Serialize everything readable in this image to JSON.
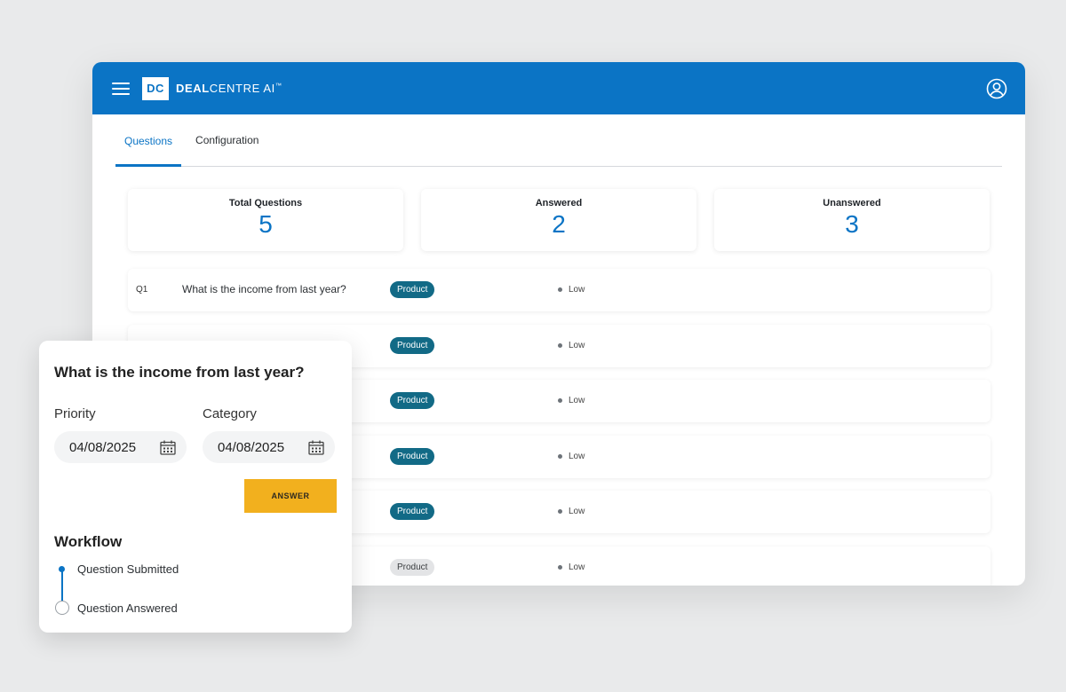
{
  "header": {
    "logo_text": "DC",
    "brand_bold": "DEAL",
    "brand_rest": "CENTRE AI",
    "brand_mark": "™"
  },
  "tabs": [
    {
      "label": "Questions",
      "active": true
    },
    {
      "label": "Configuration",
      "active": false
    }
  ],
  "stats": [
    {
      "label": "Total Questions",
      "value": "5"
    },
    {
      "label": "Answered",
      "value": "2"
    },
    {
      "label": "Unanswered",
      "value": "3"
    }
  ],
  "questions": [
    {
      "num": "Q1",
      "text": "What is the income from last year?",
      "category": "Product",
      "priority": "Low",
      "tag_style": "teal"
    },
    {
      "num": "",
      "text": "",
      "category": "Product",
      "priority": "Low",
      "tag_style": "teal"
    },
    {
      "num": "",
      "text": "",
      "category": "Product",
      "priority": "Low",
      "tag_style": "teal"
    },
    {
      "num": "",
      "text": "",
      "category": "Product",
      "priority": "Low",
      "tag_style": "teal"
    },
    {
      "num": "",
      "text": "",
      "category": "Product",
      "priority": "Low",
      "tag_style": "teal"
    },
    {
      "num": "",
      "text": "",
      "category": "Product",
      "priority": "Low",
      "tag_style": "muted"
    }
  ],
  "detail": {
    "title": "What is the income from last year?",
    "priority_label": "Priority",
    "priority_value": "04/08/2025",
    "category_label": "Category",
    "category_value": "04/08/2025",
    "answer_button": "ANSWER",
    "workflow_title": "Workflow",
    "workflow_steps": [
      {
        "label": "Question Submitted",
        "done": true
      },
      {
        "label": "Question Answered",
        "done": false
      }
    ]
  },
  "colors": {
    "primary": "#0b74c5",
    "tag_teal": "#126a86",
    "answer_button": "#f2b01e",
    "background": "#e9eaeb"
  }
}
